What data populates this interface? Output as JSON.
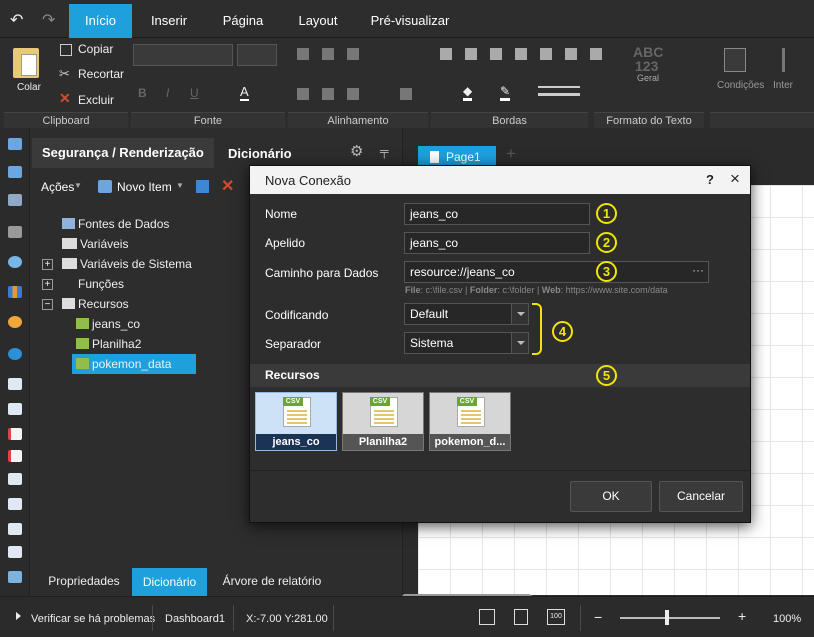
{
  "menu": {
    "tabs": [
      "Início",
      "Inserir",
      "Página",
      "Layout",
      "Pré-visualizar"
    ]
  },
  "ribbon": {
    "paste": "Colar",
    "clipboard_items": [
      "Copiar",
      "Recortar",
      "Excluir"
    ],
    "groups": [
      "Clipboard",
      "Fonte",
      "Alinhamento",
      "Bordas",
      "Formato do Texto"
    ],
    "format_general_top": "ABC",
    "format_general_mid": "123",
    "format_general": "Geral",
    "conditions": "Condições",
    "inter": "Inter"
  },
  "left_panel": {
    "tabs": [
      "Segurança / Renderização",
      "Dicionário"
    ],
    "toolbar": {
      "actions": "Ações",
      "new_item": "Novo Item"
    },
    "tree": [
      "Fontes de Dados",
      "Variáveis",
      "Variáveis de Sistema",
      "Funções",
      "Recursos",
      "jeans_co",
      "Planilha2",
      "pokemon_data"
    ],
    "bottom_tabs": [
      "Propriedades",
      "Dicionário",
      "Árvore de relatório"
    ]
  },
  "canvas": {
    "page_tab": "Page1"
  },
  "dialog": {
    "title": "Nova Conexão",
    "help": "?",
    "close": "×",
    "fields": {
      "name_label": "Nome",
      "name_value": "jeans_co",
      "alias_label": "Apelido",
      "alias_value": "jeans_co",
      "path_label": "Caminho para Dados",
      "path_value": "resource://jeans_co",
      "hint_file_label": "File",
      "hint_file": "c:\\file.csv",
      "hint_folder_label": "Folder",
      "hint_folder": "c:\\folder",
      "hint_web_label": "Web",
      "hint_web": "https://www.site.com/data",
      "encoding_label": "Codificando",
      "encoding_value": "Default",
      "separator_label": "Separador",
      "separator_value": "Sistema"
    },
    "resources_header": "Recursos",
    "resources": [
      "jeans_co",
      "Planilha2",
      "pokemon_d..."
    ],
    "resource_tag": "CSV",
    "ok": "OK",
    "cancel": "Cancelar",
    "callouts": [
      "1",
      "2",
      "3",
      "4",
      "5"
    ]
  },
  "status": {
    "check": "Verificar se há problemas",
    "page": "Dashboard1",
    "coords": "X:-7.00 Y:281.00",
    "zoom": "100%",
    "zoom_btn": "100"
  },
  "colors": {
    "accent": "#1ea0dd",
    "callout": "#f2e600"
  }
}
